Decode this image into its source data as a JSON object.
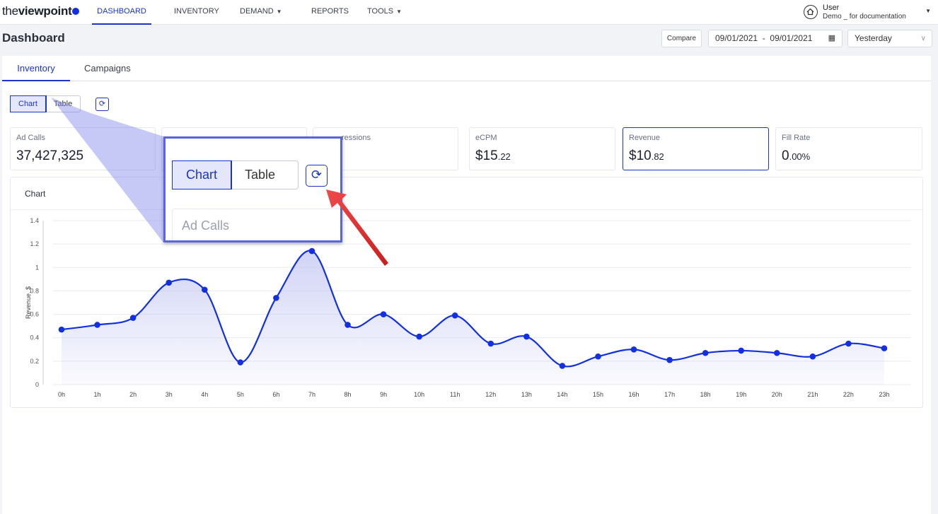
{
  "nav": {
    "logo_prefix": "the",
    "logo_bold": "viewpoint",
    "items": [
      {
        "label": "DASHBOARD"
      },
      {
        "label": "INVENTORY"
      },
      {
        "label": "DEMAND"
      },
      {
        "label": "REPORTS"
      },
      {
        "label": "TOOLS"
      }
    ],
    "user": {
      "name": "User",
      "subtitle": "Demo _ for documentation"
    }
  },
  "header": {
    "title": "Dashboard",
    "compare_label": "Compare",
    "date_range": "09/01/2021  -  09/01/2021",
    "period": "Yesterday"
  },
  "tabs": [
    {
      "label": "Inventory"
    },
    {
      "label": "Campaigns"
    }
  ],
  "view_toggle": {
    "chart_label": "Chart",
    "table_label": "Table"
  },
  "kpis": [
    {
      "label": "Ad Calls",
      "value": "37,427,325",
      "cents": ""
    },
    {
      "label": "",
      "value": "",
      "cents": ""
    },
    {
      "label": "ressions",
      "value": "",
      "cents": ""
    },
    {
      "label": "eCPM",
      "value": "$15",
      "cents": ".22"
    },
    {
      "label": "Revenue",
      "value": "$10",
      "cents": ".82"
    },
    {
      "label": "Fill Rate",
      "value": "0",
      "cents": ".00%"
    }
  ],
  "chart_card": {
    "title": "Chart"
  },
  "zoom": {
    "chart_label": "Chart",
    "table_label": "Table",
    "adcalls_label": "Ad Calls"
  },
  "colors": {
    "accent": "#1a35c8",
    "line": "#1230e0",
    "fill": "#c9ccf4",
    "arrow": "#e02a2a",
    "zoom_border": "#5a63e0"
  },
  "chart_data": {
    "type": "line",
    "title": "",
    "xlabel": "",
    "ylabel": "Revenue, $",
    "ylim": [
      0,
      1.4
    ],
    "yticks": [
      "0",
      "0.2",
      "0.4",
      "0.6",
      "0.8",
      "1",
      "1.2",
      "1.4"
    ],
    "categories": [
      "0h",
      "1h",
      "2h",
      "3h",
      "4h",
      "5h",
      "6h",
      "7h",
      "8h",
      "9h",
      "10h",
      "11h",
      "12h",
      "13h",
      "14h",
      "15h",
      "16h",
      "17h",
      "18h",
      "19h",
      "20h",
      "21h",
      "22h",
      "23h"
    ],
    "series": [
      {
        "values": [
          0.47,
          0.51,
          0.57,
          0.87,
          0.81,
          0.19,
          0.74,
          1.14,
          0.51,
          0.6,
          0.41,
          0.59,
          0.35,
          0.41,
          0.16,
          0.24,
          0.3,
          0.21,
          0.27,
          0.29,
          0.27,
          0.24,
          0.35,
          0.31
        ]
      }
    ],
    "grid": true,
    "legend": "none"
  }
}
